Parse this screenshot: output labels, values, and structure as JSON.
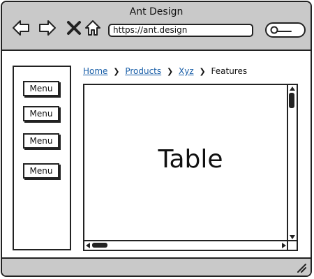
{
  "window": {
    "title": "Ant Design"
  },
  "toolbar": {
    "icons": [
      "back-arrow-icon",
      "forward-arrow-icon",
      "close-x-icon",
      "home-icon"
    ],
    "url": "https://ant.design",
    "search_icon": "search-icon"
  },
  "sidebar": {
    "items": [
      {
        "label": "Menu"
      },
      {
        "label": "Menu"
      },
      {
        "label": "Menu"
      },
      {
        "label": "Menu"
      }
    ]
  },
  "breadcrumb": {
    "items": [
      {
        "label": "Home",
        "link": true
      },
      {
        "label": "Products",
        "link": true
      },
      {
        "label": "Xyz",
        "link": true
      },
      {
        "label": "Features",
        "link": false
      }
    ],
    "separator_icon": "chevron-right-icon"
  },
  "main": {
    "table_label": "Table"
  },
  "colors": {
    "chrome": "#c9c9c9",
    "link": "#1a5fa8",
    "stroke": "#222222"
  }
}
